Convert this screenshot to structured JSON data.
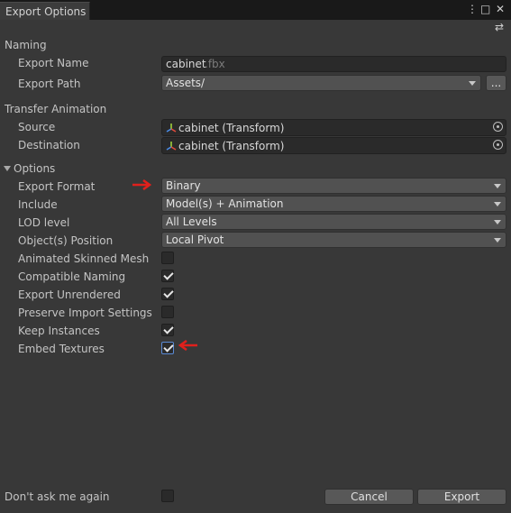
{
  "window": {
    "tab_title": "Export Options",
    "menu_glyph": "⋮",
    "maximize_glyph": "□",
    "close_glyph": "✕",
    "settings_glyph": "⇄"
  },
  "naming": {
    "header": "Naming",
    "export_name_label": "Export Name",
    "export_name_value": "cabinet",
    "export_name_ext": ".fbx",
    "export_path_label": "Export Path",
    "export_path_value": "Assets/",
    "browse_label": "..."
  },
  "transfer_animation": {
    "header": "Transfer Animation",
    "source_label": "Source",
    "source_value": "cabinet (Transform)",
    "destination_label": "Destination",
    "destination_value": "cabinet (Transform)"
  },
  "options": {
    "header": "Options",
    "export_format_label": "Export Format",
    "export_format_value": "Binary",
    "include_label": "Include",
    "include_value": "Model(s) + Animation",
    "lod_label": "LOD level",
    "lod_value": "All Levels",
    "position_label": "Object(s) Position",
    "position_value": "Local Pivot",
    "checkboxes": [
      {
        "label": "Animated Skinned Mesh",
        "checked": false
      },
      {
        "label": "Compatible Naming",
        "checked": true
      },
      {
        "label": "Export Unrendered",
        "checked": true
      },
      {
        "label": "Preserve Import Settings",
        "checked": false
      },
      {
        "label": "Keep Instances",
        "checked": true
      },
      {
        "label": "Embed Textures",
        "checked": true
      }
    ]
  },
  "footer": {
    "dont_ask_label": "Don't ask me again",
    "dont_ask_checked": false,
    "cancel_label": "Cancel",
    "export_label": "Export"
  },
  "colors": {
    "annotation_arrow": "#e0201c",
    "background": "#383838"
  }
}
